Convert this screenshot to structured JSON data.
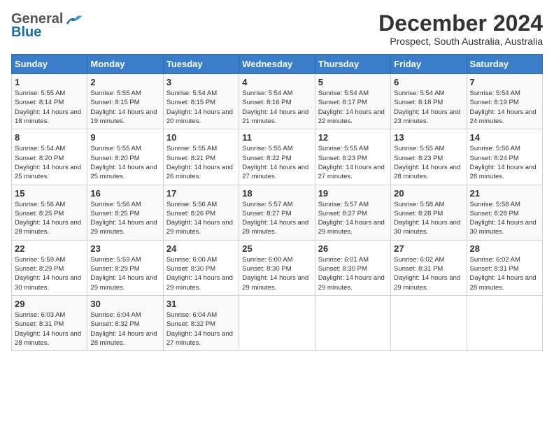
{
  "header": {
    "logo_general": "General",
    "logo_blue": "Blue",
    "month_title": "December 2024",
    "subtitle": "Prospect, South Australia, Australia"
  },
  "weekdays": [
    "Sunday",
    "Monday",
    "Tuesday",
    "Wednesday",
    "Thursday",
    "Friday",
    "Saturday"
  ],
  "weeks": [
    [
      {
        "day": "1",
        "sunrise": "Sunrise: 5:55 AM",
        "sunset": "Sunset: 8:14 PM",
        "daylight": "Daylight: 14 hours and 18 minutes."
      },
      {
        "day": "2",
        "sunrise": "Sunrise: 5:55 AM",
        "sunset": "Sunset: 8:15 PM",
        "daylight": "Daylight: 14 hours and 19 minutes."
      },
      {
        "day": "3",
        "sunrise": "Sunrise: 5:54 AM",
        "sunset": "Sunset: 8:15 PM",
        "daylight": "Daylight: 14 hours and 20 minutes."
      },
      {
        "day": "4",
        "sunrise": "Sunrise: 5:54 AM",
        "sunset": "Sunset: 8:16 PM",
        "daylight": "Daylight: 14 hours and 21 minutes."
      },
      {
        "day": "5",
        "sunrise": "Sunrise: 5:54 AM",
        "sunset": "Sunset: 8:17 PM",
        "daylight": "Daylight: 14 hours and 22 minutes."
      },
      {
        "day": "6",
        "sunrise": "Sunrise: 5:54 AM",
        "sunset": "Sunset: 8:18 PM",
        "daylight": "Daylight: 14 hours and 23 minutes."
      },
      {
        "day": "7",
        "sunrise": "Sunrise: 5:54 AM",
        "sunset": "Sunset: 8:19 PM",
        "daylight": "Daylight: 14 hours and 24 minutes."
      }
    ],
    [
      {
        "day": "8",
        "sunrise": "Sunrise: 5:54 AM",
        "sunset": "Sunset: 8:20 PM",
        "daylight": "Daylight: 14 hours and 25 minutes."
      },
      {
        "day": "9",
        "sunrise": "Sunrise: 5:55 AM",
        "sunset": "Sunset: 8:20 PM",
        "daylight": "Daylight: 14 hours and 25 minutes."
      },
      {
        "day": "10",
        "sunrise": "Sunrise: 5:55 AM",
        "sunset": "Sunset: 8:21 PM",
        "daylight": "Daylight: 14 hours and 26 minutes."
      },
      {
        "day": "11",
        "sunrise": "Sunrise: 5:55 AM",
        "sunset": "Sunset: 8:22 PM",
        "daylight": "Daylight: 14 hours and 27 minutes."
      },
      {
        "day": "12",
        "sunrise": "Sunrise: 5:55 AM",
        "sunset": "Sunset: 8:23 PM",
        "daylight": "Daylight: 14 hours and 27 minutes."
      },
      {
        "day": "13",
        "sunrise": "Sunrise: 5:55 AM",
        "sunset": "Sunset: 8:23 PM",
        "daylight": "Daylight: 14 hours and 28 minutes."
      },
      {
        "day": "14",
        "sunrise": "Sunrise: 5:56 AM",
        "sunset": "Sunset: 8:24 PM",
        "daylight": "Daylight: 14 hours and 28 minutes."
      }
    ],
    [
      {
        "day": "15",
        "sunrise": "Sunrise: 5:56 AM",
        "sunset": "Sunset: 8:25 PM",
        "daylight": "Daylight: 14 hours and 28 minutes."
      },
      {
        "day": "16",
        "sunrise": "Sunrise: 5:56 AM",
        "sunset": "Sunset: 8:25 PM",
        "daylight": "Daylight: 14 hours and 29 minutes."
      },
      {
        "day": "17",
        "sunrise": "Sunrise: 5:56 AM",
        "sunset": "Sunset: 8:26 PM",
        "daylight": "Daylight: 14 hours and 29 minutes."
      },
      {
        "day": "18",
        "sunrise": "Sunrise: 5:57 AM",
        "sunset": "Sunset: 8:27 PM",
        "daylight": "Daylight: 14 hours and 29 minutes."
      },
      {
        "day": "19",
        "sunrise": "Sunrise: 5:57 AM",
        "sunset": "Sunset: 8:27 PM",
        "daylight": "Daylight: 14 hours and 29 minutes."
      },
      {
        "day": "20",
        "sunrise": "Sunrise: 5:58 AM",
        "sunset": "Sunset: 8:28 PM",
        "daylight": "Daylight: 14 hours and 30 minutes."
      },
      {
        "day": "21",
        "sunrise": "Sunrise: 5:58 AM",
        "sunset": "Sunset: 8:28 PM",
        "daylight": "Daylight: 14 hours and 30 minutes."
      }
    ],
    [
      {
        "day": "22",
        "sunrise": "Sunrise: 5:59 AM",
        "sunset": "Sunset: 8:29 PM",
        "daylight": "Daylight: 14 hours and 30 minutes."
      },
      {
        "day": "23",
        "sunrise": "Sunrise: 5:59 AM",
        "sunset": "Sunset: 8:29 PM",
        "daylight": "Daylight: 14 hours and 29 minutes."
      },
      {
        "day": "24",
        "sunrise": "Sunrise: 6:00 AM",
        "sunset": "Sunset: 8:30 PM",
        "daylight": "Daylight: 14 hours and 29 minutes."
      },
      {
        "day": "25",
        "sunrise": "Sunrise: 6:00 AM",
        "sunset": "Sunset: 8:30 PM",
        "daylight": "Daylight: 14 hours and 29 minutes."
      },
      {
        "day": "26",
        "sunrise": "Sunrise: 6:01 AM",
        "sunset": "Sunset: 8:30 PM",
        "daylight": "Daylight: 14 hours and 29 minutes."
      },
      {
        "day": "27",
        "sunrise": "Sunrise: 6:02 AM",
        "sunset": "Sunset: 8:31 PM",
        "daylight": "Daylight: 14 hours and 29 minutes."
      },
      {
        "day": "28",
        "sunrise": "Sunrise: 6:02 AM",
        "sunset": "Sunset: 8:31 PM",
        "daylight": "Daylight: 14 hours and 28 minutes."
      }
    ],
    [
      {
        "day": "29",
        "sunrise": "Sunrise: 6:03 AM",
        "sunset": "Sunset: 8:31 PM",
        "daylight": "Daylight: 14 hours and 28 minutes."
      },
      {
        "day": "30",
        "sunrise": "Sunrise: 6:04 AM",
        "sunset": "Sunset: 8:32 PM",
        "daylight": "Daylight: 14 hours and 28 minutes."
      },
      {
        "day": "31",
        "sunrise": "Sunrise: 6:04 AM",
        "sunset": "Sunset: 8:32 PM",
        "daylight": "Daylight: 14 hours and 27 minutes."
      },
      null,
      null,
      null,
      null
    ]
  ]
}
